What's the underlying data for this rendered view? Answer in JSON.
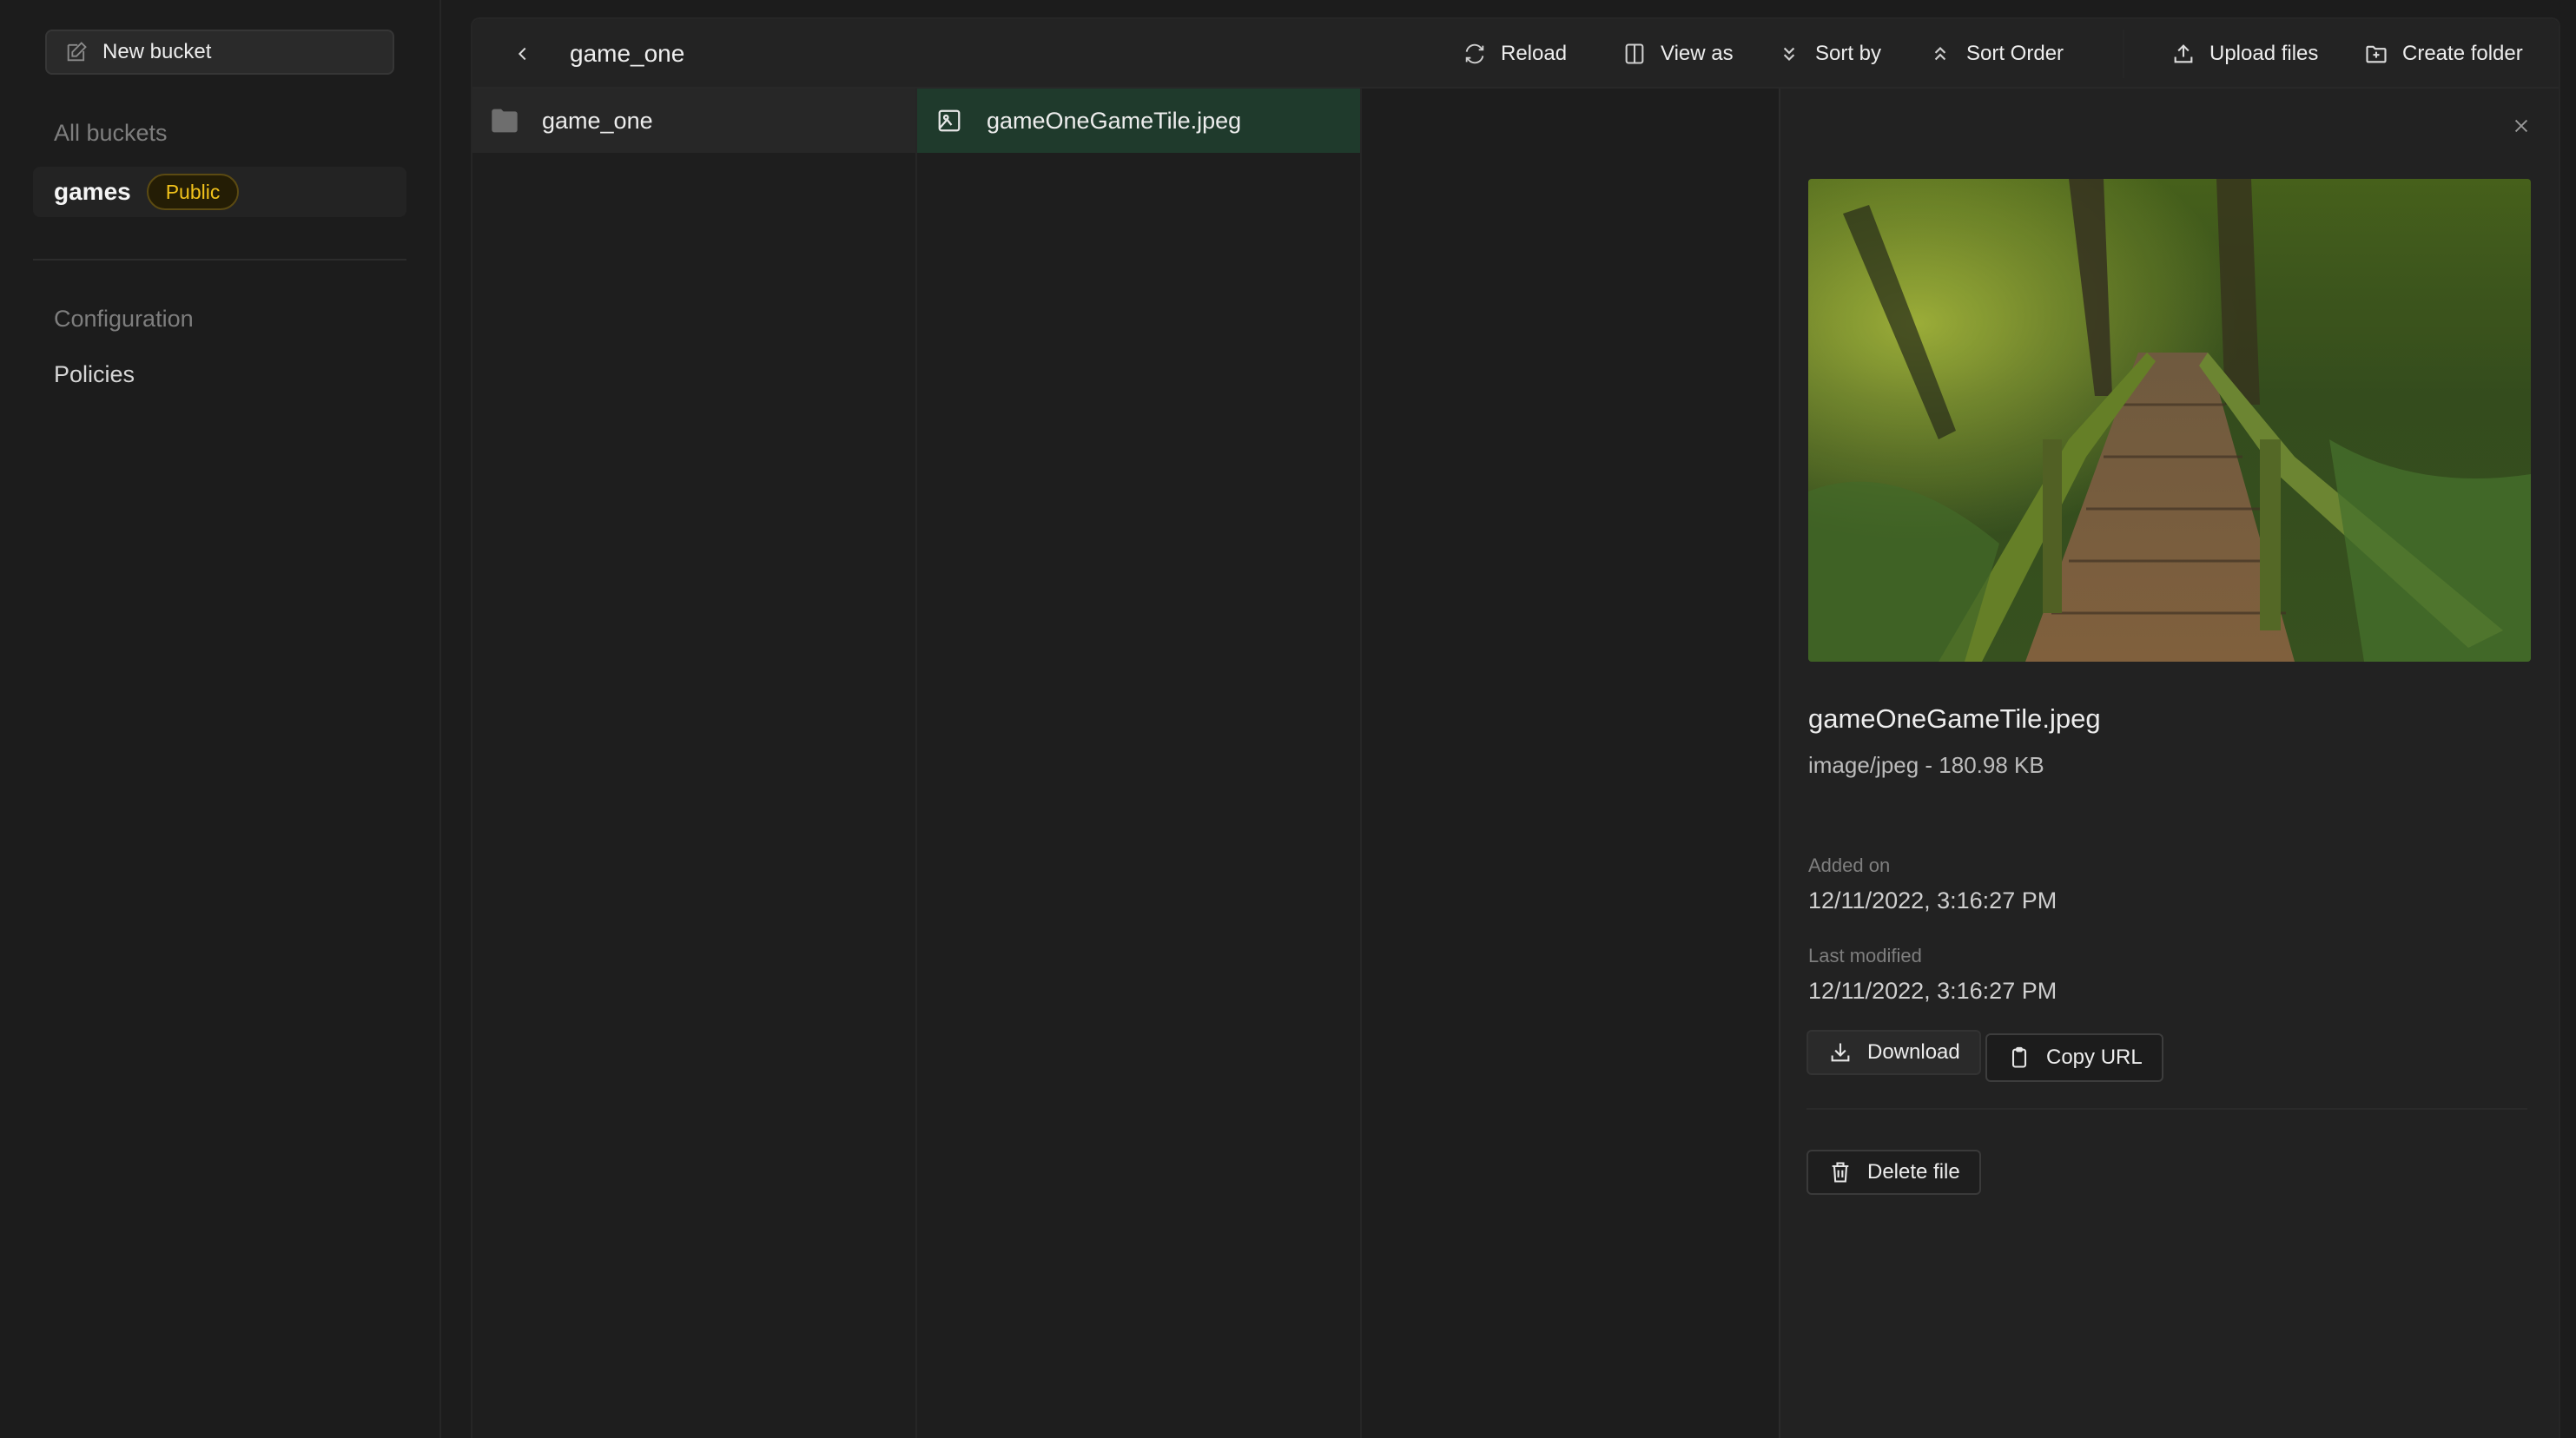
{
  "sidebar": {
    "new_bucket_label": "New bucket",
    "all_buckets_heading": "All buckets",
    "buckets": [
      {
        "name": "games",
        "badge": "Public",
        "selected": true
      }
    ],
    "configuration_heading": "Configuration",
    "links": [
      {
        "label": "Policies"
      }
    ]
  },
  "toolbar": {
    "breadcrumb": "game_one",
    "reload": "Reload",
    "view_as": "View as",
    "sort_by": "Sort by",
    "sort_order": "Sort Order",
    "upload_files": "Upload files",
    "create_folder": "Create folder"
  },
  "columns": [
    {
      "items": [
        {
          "type": "folder",
          "name": "game_one"
        }
      ]
    },
    {
      "items": [
        {
          "type": "image",
          "name": "gameOneGameTile.jpeg",
          "selected": true
        }
      ]
    },
    {
      "items": []
    }
  ],
  "detail": {
    "preview_alt": "Mossy wooden bridge in a forest",
    "file_name": "gameOneGameTile.jpeg",
    "file_meta": "image/jpeg - 180.98 KB",
    "added_on_label": "Added on",
    "added_on": "12/11/2022, 3:16:27 PM",
    "last_modified_label": "Last modified",
    "last_modified": "12/11/2022, 3:16:27 PM",
    "download_label": "Download",
    "copy_url_label": "Copy URL",
    "delete_label": "Delete file"
  },
  "colors": {
    "accent_badge": "#f1c21b",
    "selected_row": "#1f3a2c"
  }
}
